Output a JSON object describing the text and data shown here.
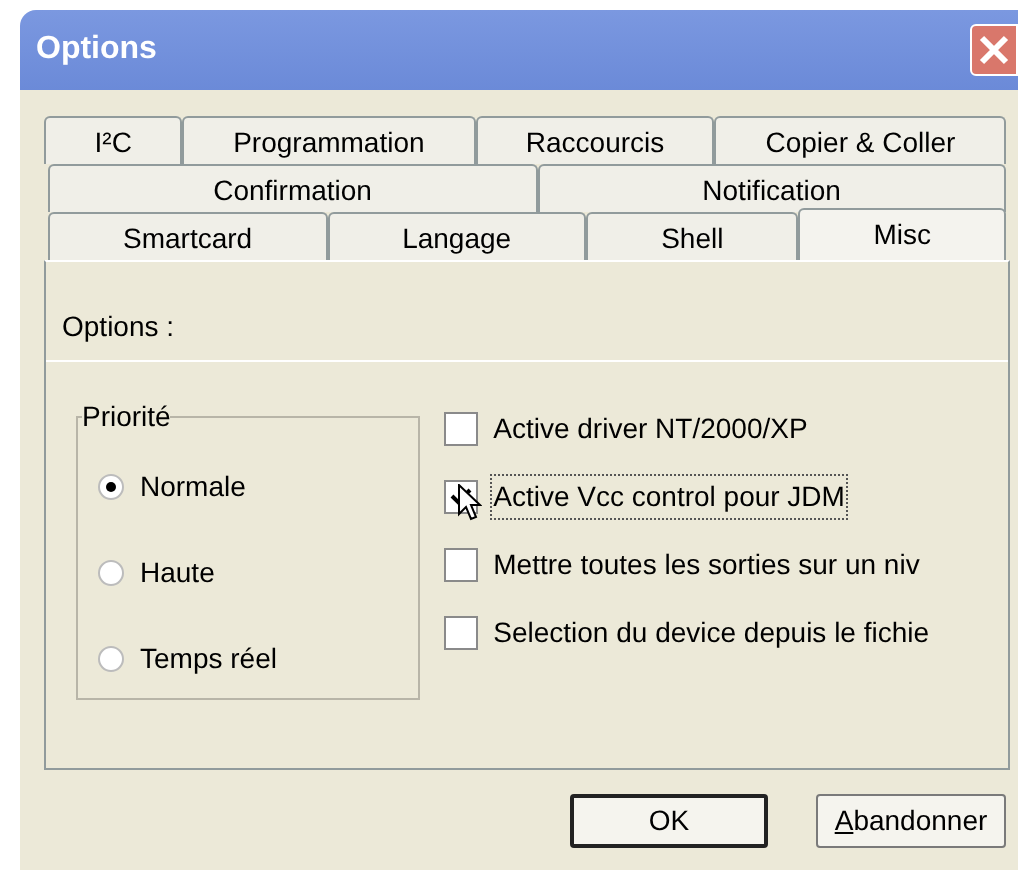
{
  "window": {
    "title": "Options"
  },
  "tab_rows": [
    [
      {
        "label": "I²C",
        "selected": false
      },
      {
        "label": "Programmation",
        "selected": false
      },
      {
        "label": "Raccourcis",
        "selected": false
      },
      {
        "label": "Copier & Coller",
        "selected": false
      }
    ],
    [
      {
        "label": "Confirmation",
        "selected": false
      },
      {
        "label": "Notification",
        "selected": false
      }
    ],
    [
      {
        "label": "Smartcard",
        "selected": false
      },
      {
        "label": "Langage",
        "selected": false
      },
      {
        "label": "Shell",
        "selected": false
      },
      {
        "label": "Misc",
        "selected": true
      }
    ]
  ],
  "section_title": "Options :",
  "priority": {
    "title": "Priorité",
    "options": [
      {
        "label": "Normale",
        "selected": true
      },
      {
        "label": "Haute",
        "selected": false
      },
      {
        "label": "Temps réel",
        "selected": false
      }
    ]
  },
  "checkboxes": [
    {
      "label": "Active driver NT/2000/XP",
      "checked": false,
      "focused": false
    },
    {
      "label": "Active Vcc control pour JDM",
      "checked": true,
      "focused": true
    },
    {
      "label": "Mettre toutes les sorties sur un niv",
      "checked": false,
      "focused": false
    },
    {
      "label": "Selection du device depuis le fichie",
      "checked": false,
      "focused": false
    }
  ],
  "buttons": [
    {
      "label": "OK",
      "default": true,
      "underline_first": false
    },
    {
      "label": "Abandonner",
      "default": false,
      "underline_first": true
    }
  ]
}
